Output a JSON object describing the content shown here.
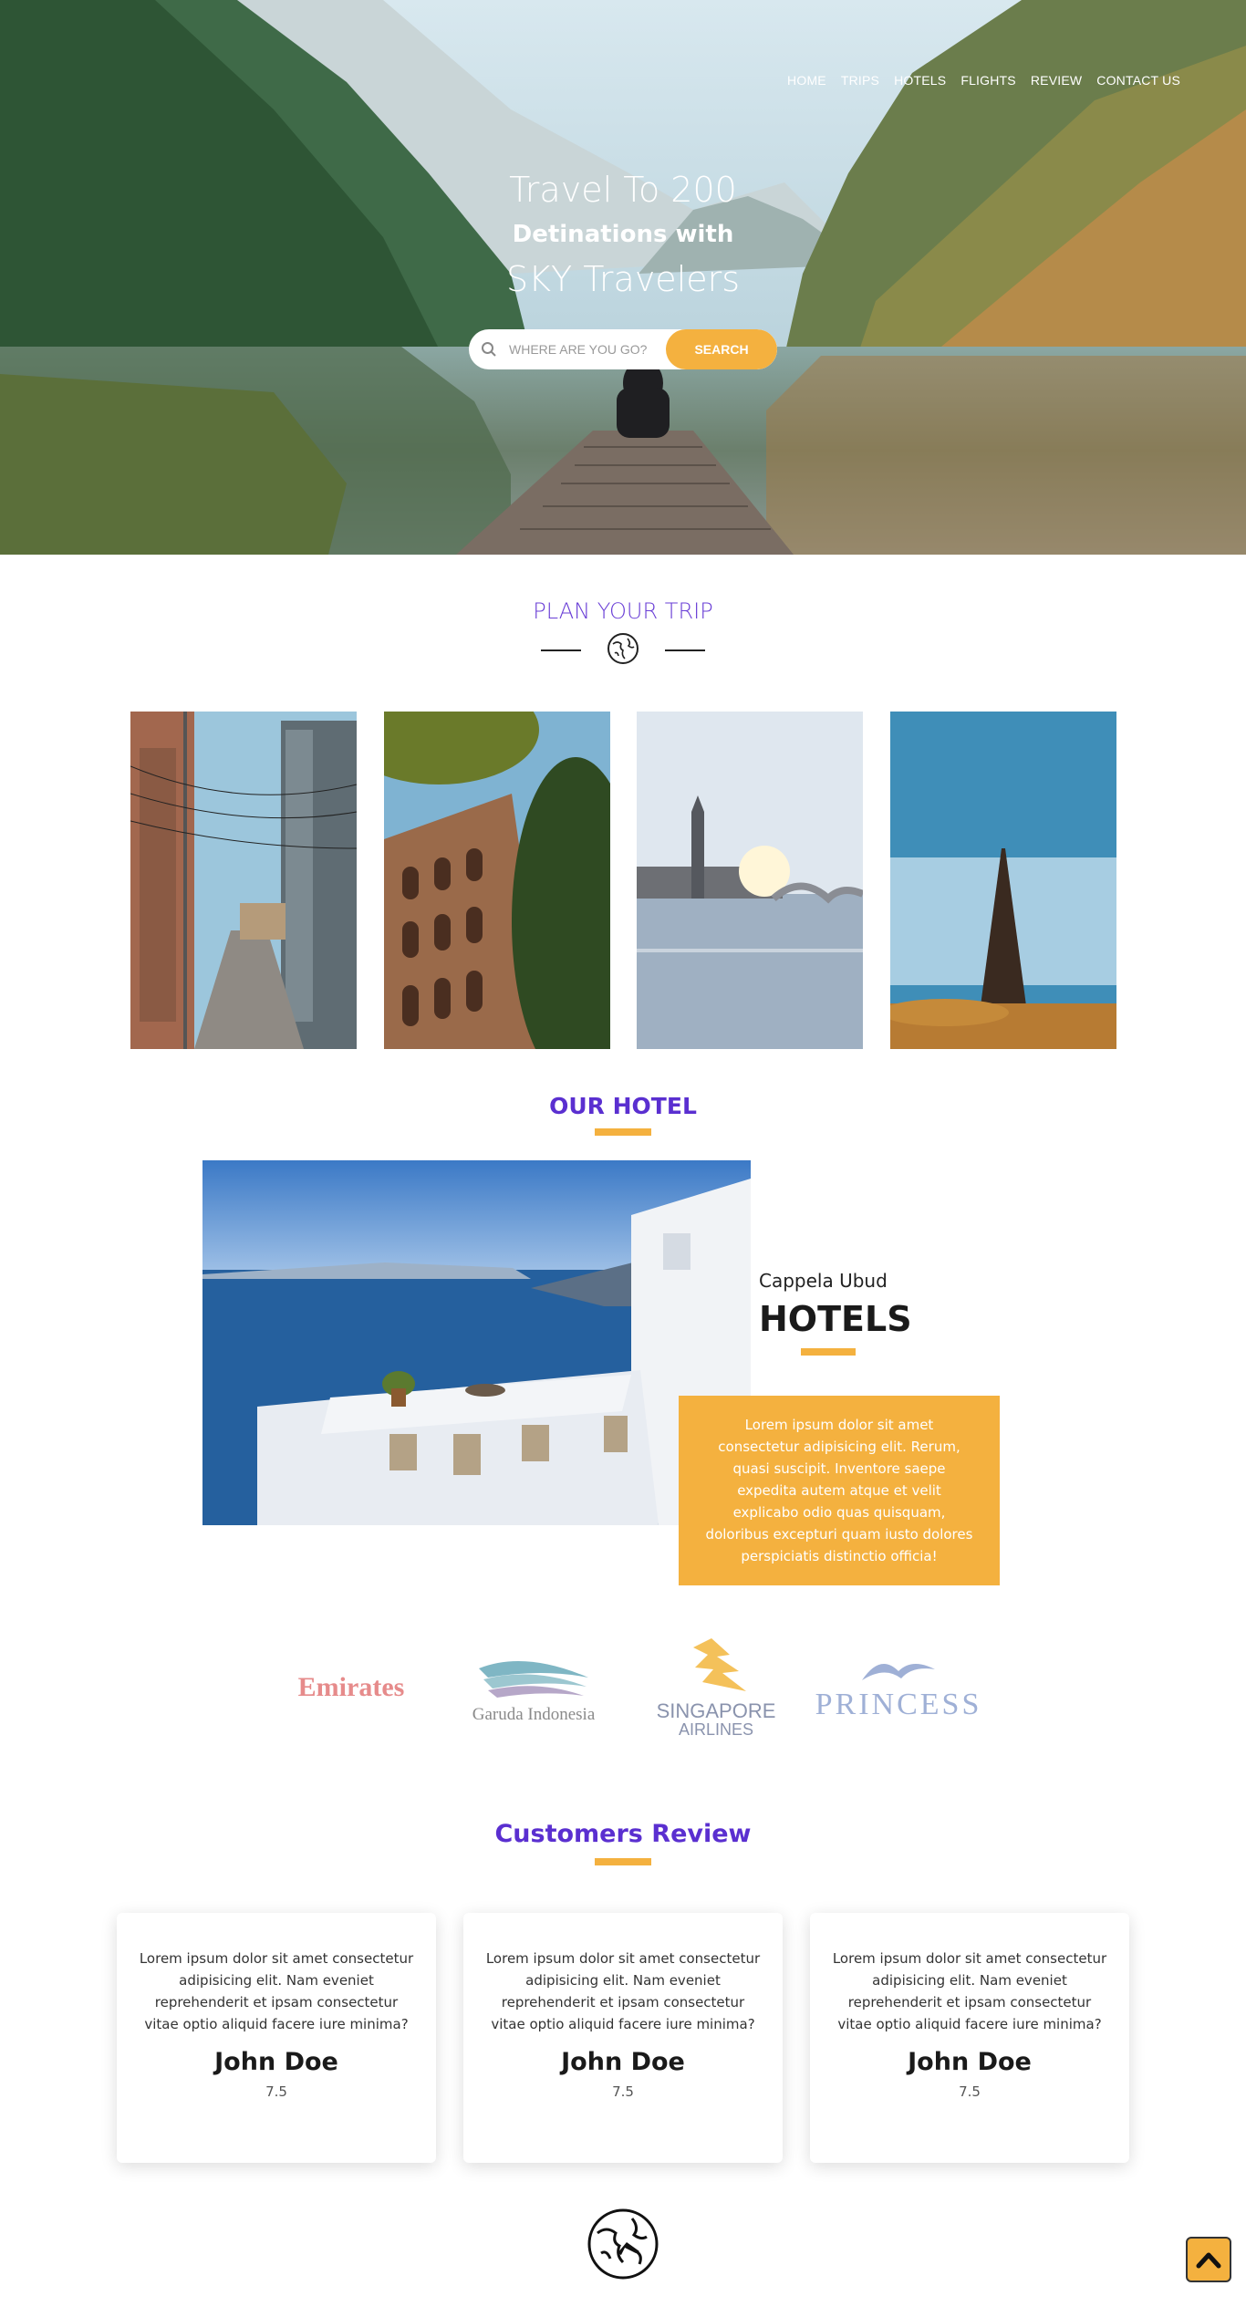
{
  "nav": {
    "items": [
      {
        "label": "HOME"
      },
      {
        "label": "TRIPS"
      },
      {
        "label": "HOTELS"
      },
      {
        "label": "FLIGHTS"
      },
      {
        "label": "REVIEW"
      },
      {
        "label": "CONTACT US"
      }
    ]
  },
  "hero": {
    "line1": "Travel To 200",
    "line2": "Detinations with",
    "line3": "SKY Travelers",
    "search_placeholder": "WHERE ARE YOU GO?",
    "search_button": "SEARCH"
  },
  "plan": {
    "title": "PLAN YOUR TRIP",
    "icon": "globe-icon",
    "destinations": [
      {
        "icon": "city-street-photo"
      },
      {
        "icon": "colosseum-photo"
      },
      {
        "icon": "big-ben-photo"
      },
      {
        "icon": "eiffel-tower-photo"
      }
    ]
  },
  "hotel": {
    "section_title": "OUR HOTEL",
    "subtitle": "Cappela Ubud",
    "name": "HOTELS",
    "description": "Lorem ipsum dolor sit amet consectetur adipisicing elit. Rerum, quasi suscipit. Inventore saepe expedita autem atque et velit explicabo odio quas quisquam, doloribus excepturi quam iusto dolores perspiciatis distinctio officia!"
  },
  "partners": {
    "items": [
      {
        "label": "Emirates",
        "color": "#e68b8b"
      },
      {
        "label": "Garuda Indonesia",
        "color": "#8a8a8a"
      },
      {
        "label": "SINGAPORE",
        "label2": "AIRLINES",
        "color": "#f4c15a"
      },
      {
        "label": "PRINCESS",
        "color": "#9fb0d6"
      }
    ]
  },
  "reviews": {
    "title": "Customers Review",
    "items": [
      {
        "text": "Lorem ipsum dolor sit amet consectetur adipisicing elit. Nam eveniet reprehenderit et ipsam consectetur vitae optio aliquid facere iure minima?",
        "name": "John Doe",
        "score": "7.5"
      },
      {
        "text": "Lorem ipsum dolor sit amet consectetur adipisicing elit. Nam eveniet reprehenderit et ipsam consectetur vitae optio aliquid facere iure minima?",
        "name": "John Doe",
        "score": "7.5"
      },
      {
        "text": "Lorem ipsum dolor sit amet consectetur adipisicing elit. Nam eveniet reprehenderit et ipsam consectetur vitae optio aliquid facere iure minima?",
        "name": "John Doe",
        "score": "7.5"
      }
    ]
  },
  "colors": {
    "accent": "#f4b13f",
    "heading_purple": "#5a2fd0"
  },
  "footer": {
    "icon": "globe-icon",
    "back_to_top_icon": "chevron-up-icon"
  }
}
